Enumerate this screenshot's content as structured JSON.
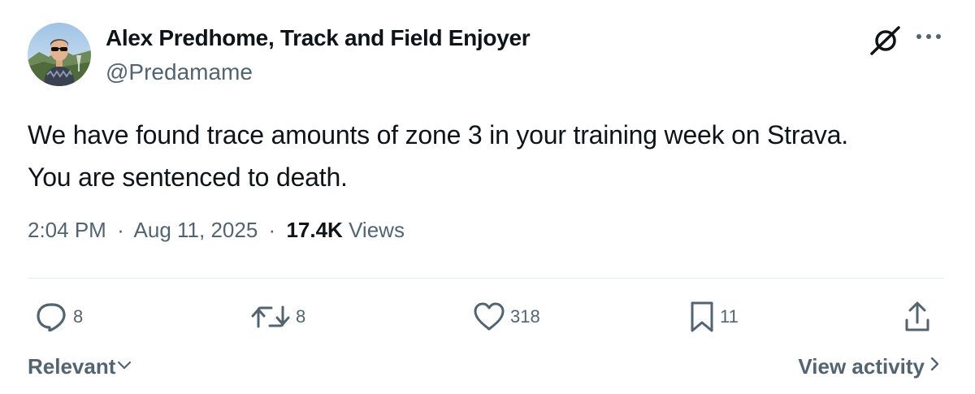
{
  "author": {
    "name": "Alex Predhome, Track and Field Enjoyer",
    "handle": "@Predamame"
  },
  "tweet": {
    "text_line1": "We have found trace amounts of zone 3 in your training week on Strava.",
    "text_line2": "You are sentenced to death."
  },
  "meta": {
    "time": "2:04 PM",
    "separator": "·",
    "date": "Aug 11, 2025",
    "views_count": "17.4K",
    "views_label": "Views"
  },
  "actions": {
    "replies": "8",
    "reposts": "8",
    "likes": "318",
    "bookmarks": "11"
  },
  "footer": {
    "sort_label": "Relevant",
    "view_activity_label": "View activity"
  },
  "colors": {
    "text_primary": "#0f1419",
    "text_secondary": "#536471",
    "divider": "#e6ecf0"
  },
  "icons": {
    "top_right": [
      "grok-icon",
      "more-icon"
    ],
    "actions": [
      "reply-icon",
      "retweet-icon",
      "like-icon",
      "bookmark-icon",
      "share-icon"
    ]
  }
}
